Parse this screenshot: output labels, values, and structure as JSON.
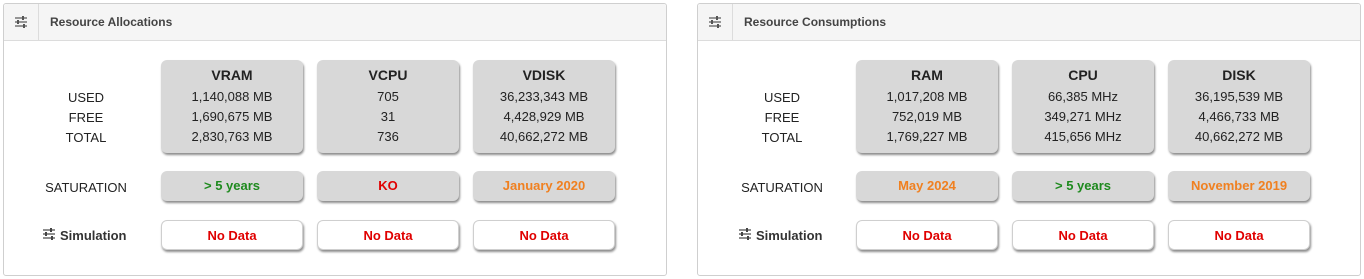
{
  "colors": {
    "green": "#1e8a1e",
    "red": "#e00000",
    "orange": "#f08020"
  },
  "row_labels": {
    "used": "USED",
    "free": "FREE",
    "total": "TOTAL",
    "saturation": "SATURATION",
    "simulation": "Simulation"
  },
  "allocations": {
    "title": "Resource Allocations",
    "cards": [
      {
        "title": "VRAM",
        "used": "1,140,088 MB",
        "free": "1,690,675 MB",
        "total": "2,830,763 MB",
        "saturation": "> 5 years",
        "saturation_color": "green",
        "simulation": "No Data"
      },
      {
        "title": "VCPU",
        "used": "705",
        "free": "31",
        "total": "736",
        "saturation": "KO",
        "saturation_color": "red",
        "simulation": "No Data"
      },
      {
        "title": "VDISK",
        "used": "36,233,343 MB",
        "free": "4,428,929 MB",
        "total": "40,662,272 MB",
        "saturation": "January 2020",
        "saturation_color": "orange",
        "simulation": "No Data"
      }
    ]
  },
  "consumptions": {
    "title": "Resource Consumptions",
    "cards": [
      {
        "title": "RAM",
        "used": "1,017,208 MB",
        "free": "752,019 MB",
        "total": "1,769,227 MB",
        "saturation": "May 2024",
        "saturation_color": "orange",
        "simulation": "No Data"
      },
      {
        "title": "CPU",
        "used": "66,385 MHz",
        "free": "349,271 MHz",
        "total": "415,656 MHz",
        "saturation": "> 5 years",
        "saturation_color": "green",
        "simulation": "No Data"
      },
      {
        "title": "DISK",
        "used": "36,195,539 MB",
        "free": "4,466,733 MB",
        "total": "40,662,272 MB",
        "saturation": "November 2019",
        "saturation_color": "orange",
        "simulation": "No Data"
      }
    ]
  }
}
